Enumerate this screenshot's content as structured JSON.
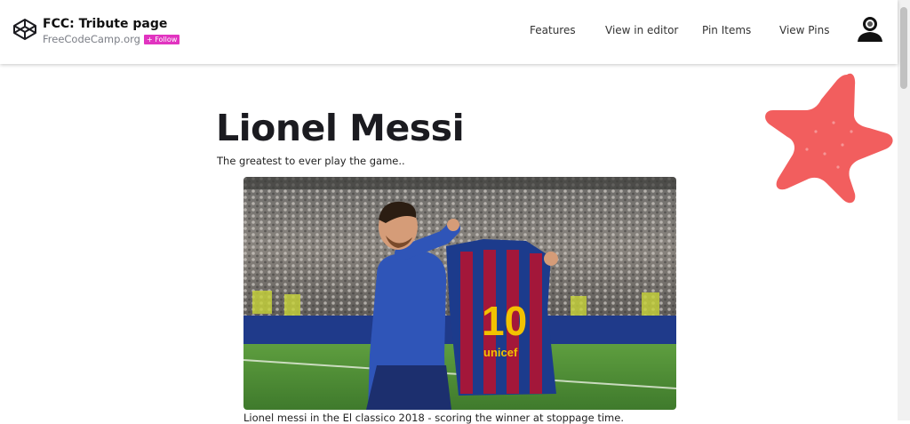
{
  "header": {
    "title": "FCC: Tribute page",
    "author": "FreeCodeCamp.org",
    "follow_label": "+ Follow",
    "logo_icon": "codepen-cube-icon",
    "avatar_icon": "user-avatar-icon"
  },
  "nav": {
    "items": [
      {
        "label": "Features"
      },
      {
        "label": "View in editor"
      },
      {
        "label": "Pin Items"
      },
      {
        "label": "View Pins"
      }
    ]
  },
  "main": {
    "title": "Lionel Messi",
    "subtitle": "The greatest to ever play the game..",
    "image": {
      "jersey_number": "10",
      "jersey_sponsor": "unicef",
      "description_icon": "messi-holding-jersey-photo"
    },
    "caption": "Lionel messi in the El classico 2018 - scoring the winner at stoppage time."
  },
  "decor": {
    "star_color": "#f25e5e",
    "star_icon": "star-icon"
  },
  "colors": {
    "follow_bg": "#e134c0",
    "text": "#1b1b20"
  }
}
